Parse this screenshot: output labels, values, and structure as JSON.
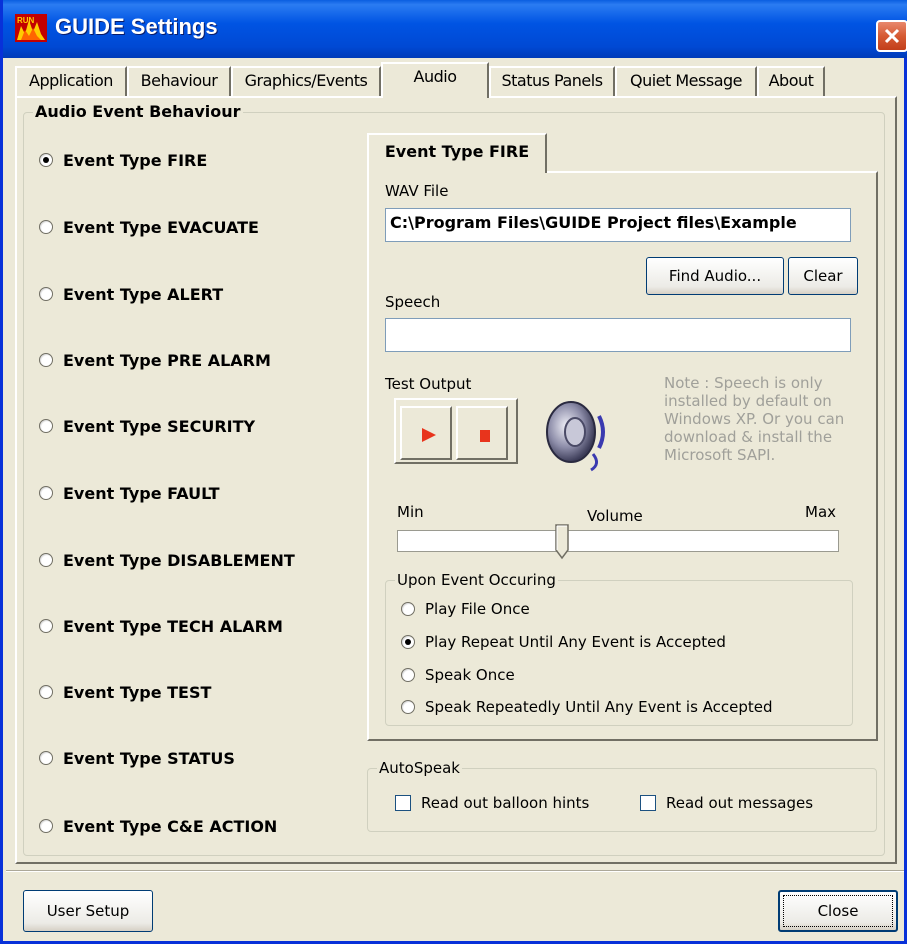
{
  "window": {
    "title": "GUIDE Settings"
  },
  "tabs": [
    "Application",
    "Behaviour",
    "Graphics/Events",
    "Audio",
    "Status Panels",
    "Quiet Message",
    "About"
  ],
  "group_title": "Audio Event Behaviour",
  "events": [
    "Event Type FIRE",
    "Event Type EVACUATE",
    "Event Type ALERT",
    "Event Type PRE ALARM",
    "Event Type SECURITY",
    "Event Type FAULT",
    "Event Type DISABLEMENT",
    "Event Type TECH ALARM",
    "Event Type TEST",
    "Event Type STATUS",
    "Event Type C&E ACTION"
  ],
  "selected_event": "Event Type FIRE",
  "detail": {
    "tab_label": "Event Type FIRE",
    "wav_label": "WAV File",
    "wav_value": "C:\\Program Files\\GUIDE Project files\\Example",
    "find_audio": "Find Audio...",
    "clear": "Clear",
    "speech_label": "Speech",
    "speech_value": "",
    "test_output_label": "Test Output",
    "note": "Note : Speech is only installed by default on Windows XP. Or you can download & install the Microsoft SAPI.",
    "volume_min": "Min",
    "volume_label": "Volume",
    "volume_max": "Max",
    "volume_level": 0.37,
    "upon_event_title": "Upon Event Occuring",
    "upon_event_options": [
      "Play File Once",
      "Play Repeat Until Any Event is Accepted",
      "Speak Once",
      "Speak Repeatedly Until Any Event is Accepted"
    ],
    "upon_event_selected": "Play Repeat Until Any Event is Accepted"
  },
  "autospeak": {
    "title": "AutoSpeak",
    "read_balloon": "Read out balloon hints",
    "read_messages": "Read out messages"
  },
  "footer": {
    "user_setup": "User Setup",
    "close": "Close"
  },
  "colors": {
    "titlebar": "#0054e3",
    "play_icon": "#e8341c",
    "stop_icon": "#e8341c",
    "face": "#ece9d8"
  }
}
